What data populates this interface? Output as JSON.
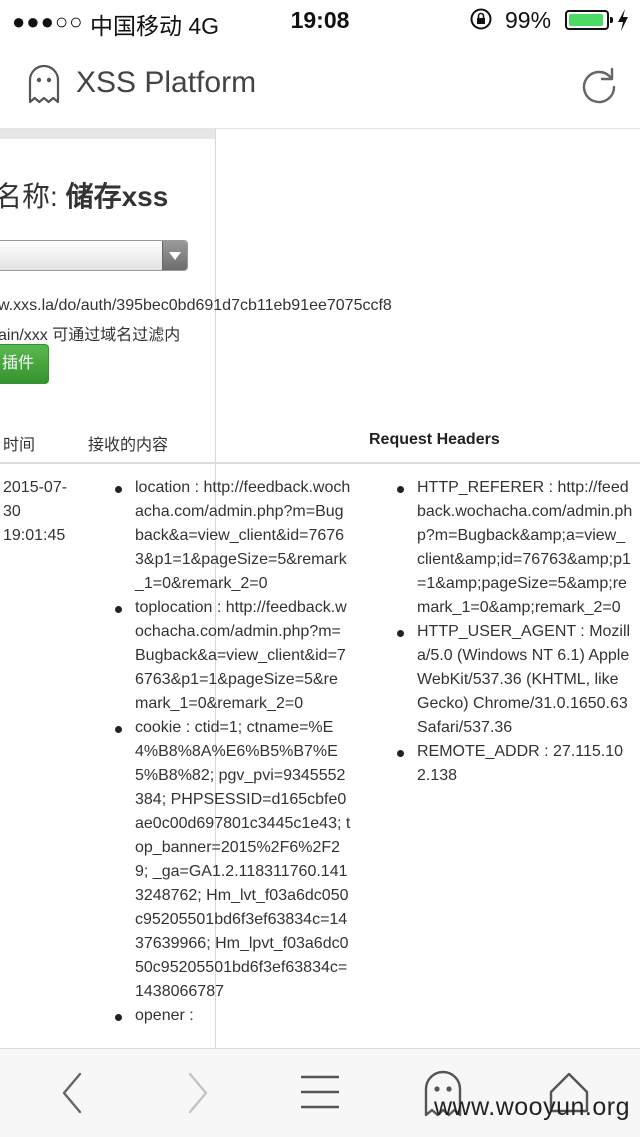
{
  "status_bar": {
    "signal": "●●●○○",
    "carrier": "中国移动  4G",
    "time": "19:08",
    "battery_percent": "99%",
    "battery_level": 0.99,
    "battery_color": "#4cd964"
  },
  "header": {
    "title": "XSS Platform",
    "left_icon": "ghost-icon",
    "right_icon": "reload-icon"
  },
  "project": {
    "name_prefix": "名称: ",
    "name_value": "储存xss",
    "url": "w.xxs.la/do/auth/395bec0bd691d7cb11eb91ee7075ccf8",
    "domain_hint": "ain/xxx 可通过域名过滤内",
    "plugin_button": "插件",
    "button_color": "#36922e"
  },
  "table": {
    "col_time": "时间",
    "col_content": "接收的内容",
    "col_headers": "Request Headers",
    "row": {
      "date": "2015-07-30 19:01:45",
      "content_items": [
        "location : http://feedback.wochacha.com/admin.php?m=Bugback&a=view_client&id=76763&p1=1&pageSize=5&remark_1=0&remark_2=0",
        "toplocation : http://feedback.wochacha.com/admin.php?m=Bugback&a=view_client&id=76763&p1=1&pageSize=5&remark_1=0&remark_2=0",
        "cookie : ctid=1; ctname=%E4%B8%8A%E6%B5%B7%E5%B8%82; pgv_pvi=9345552384; PHPSESSID=d165cbfe0ae0c00d697801c3445c1e43; top_banner=2015%2F6%2F29; _ga=GA1.2.118311760.1413248762; Hm_lvt_f03a6dc050c95205501bd6f3ef63834c=1437639966; Hm_lpvt_f03a6dc050c95205501bd6f3ef63834c=1438066787",
        "opener :"
      ],
      "header_items": [
        "HTTP_REFERER : http://feedback.wochacha.com/admin.php?m=Bugback&amp;a=view_client&amp;id=76763&amp;p1=1&amp;pageSize=5&amp;remark_1=0&amp;remark_2=0",
        "HTTP_USER_AGENT : Mozilla/5.0 (Windows NT 6.1) AppleWebKit/537.36 (KHTML, like Gecko) Chrome/31.0.1650.63 Safari/537.36",
        "REMOTE_ADDR : 27.115.102.138"
      ]
    }
  },
  "toolbar": {
    "back_icon": "back-chevron-icon",
    "forward_icon": "forward-chevron-icon",
    "menu_icon": "hamburger-menu-icon",
    "ghost_icon": "ghost-icon",
    "home_icon": "home-icon"
  },
  "watermark": "www.wooyun.org"
}
